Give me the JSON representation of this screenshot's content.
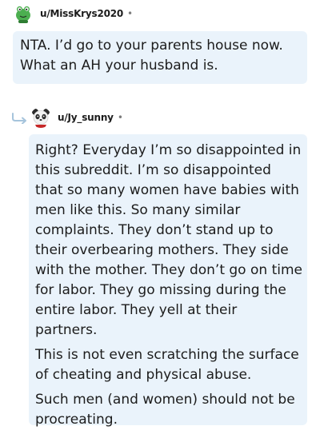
{
  "comment": {
    "username": "u/MissKrys2020",
    "separator": "•",
    "body": "NTA. I’d go to your parents house now. What an AH your husband is."
  },
  "reply": {
    "username": "u/Jy_sunny",
    "separator": "•",
    "paragraphs": [
      "Right? Everyday I’m so disappointed in this subreddit. I’m so disappointed that so many women have babies with men like this. So many similar complaints. They don’t stand up to their overbearing mothers. They side with the mother. They don’t go on time for labor. They go missing during the entire labor. They yell at their partners.",
      "This is not even scratching the surface of cheating and physical abuse.",
      "Such men (and women) should not be procreating."
    ]
  },
  "colors": {
    "bubble": "#eaf3fb",
    "text": "#1c1c1c",
    "meta": "#7c7c7c",
    "reply_arrow": "#a6c4dc"
  },
  "icons": {
    "comment_avatar": "green-frog-avatar-icon",
    "reply_avatar": "panda-avatar-icon",
    "reply_indicator": "reply-arrow-icon"
  }
}
